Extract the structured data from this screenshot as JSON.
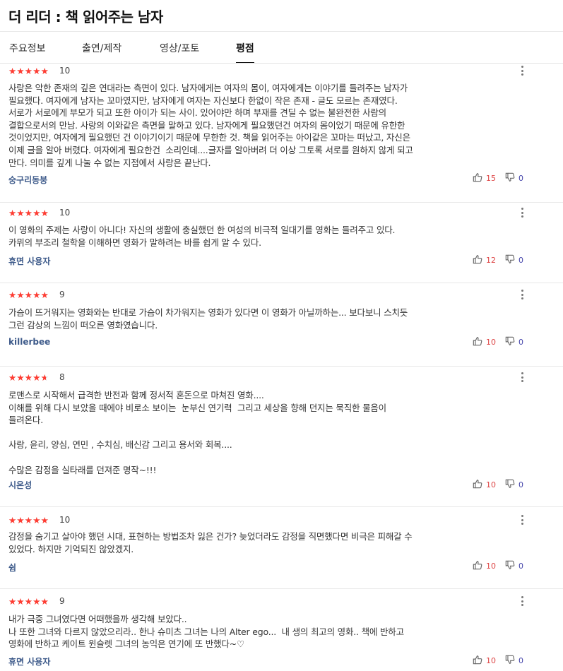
{
  "page": {
    "title": "더 리더 : 책 읽어주는 남자"
  },
  "tabs": [
    {
      "label": "주요정보",
      "active": false
    },
    {
      "label": "출연/제작",
      "active": false
    },
    {
      "label": "영상/포토",
      "active": false
    },
    {
      "label": "평점",
      "active": true
    }
  ],
  "reviews": [
    {
      "rating": 10,
      "score": "10",
      "text": "사랑은 악한 존재의 깊은 연대라는 측면이 있다. 남자에게는 여자의 몸이, 여자에게는 이야기를 들려주는 남자가\n필요했다. 여자에게 남자는 꼬마였지만, 남자에게 여자는 자신보다 한없이 작은 존재 - 글도 모르는 존재였다.\n서로가 서로에게 부모가 되고 또한 아이가 되는 사이. 있어야만 하며 부재를 견딜 수 없는 불완전한 사람의\n결합으로서의 만남. 사랑의 이와같은 측면을 말하고 있다. 남자에게 필요했던건 여자의 몸이었기 때문에 유한한\n것이었지만, 여자에게 필요했던 건 이야기이기 때문에 무한한 것. 책을 읽어주는 아이같은 꼬마는 떠났고, 자신은\n이제 글을 알아 버렸다. 여자에게 필요한건  소리인데....글자를 알아버려 더 이상 그토록 서로를 원하지 않게 되고\n만다. 의미를 깊게 나눌 수 없는 지점에서 사랑은 끝난다.",
      "user": "숭구리동붕",
      "likes": "15",
      "dislikes": "0"
    },
    {
      "rating": 10,
      "score": "10",
      "text": "이 영화의 주제는 사랑이 아니다! 자신의 생활에 충실했던 한 여성의 비극적 일대기를 영화는 들려주고 있다.\n카뮈의 부조리 철학을 이해하면 영화가 말하려는 바를 쉽게 알 수 있다.",
      "user": "휴면 사용자",
      "likes": "12",
      "dislikes": "0"
    },
    {
      "rating": 9,
      "score": "9",
      "text": "가슴이 뜨거워지는 영화와는 반대로 가슴이 차가워지는 영화가 있다면 이 영화가 아닐까하는... 보다보니 스치듯\n그런 감상의 느낌이 떠오른 영화였습니다.",
      "user": "killerbee",
      "likes": "10",
      "dislikes": "0"
    },
    {
      "rating": 8,
      "score": "8",
      "text": "로맨스로 시작해서 급격한 반전과 함께 정서적 혼돈으로 마쳐진 영화....\n이해를 위해 다시 보았을 때에야 비로소 보이는  눈부신 연기력  그리고 세상을 향해 던지는 묵직한 물음이\n들려온다.\n\n사랑, 윤리, 양심, 연민 , 수치심, 배신감 그리고 용서와 회복....\n\n수많은 감정을 실타래를 던져준 명작~!!!",
      "user": "시온성",
      "likes": "10",
      "dislikes": "0"
    },
    {
      "rating": 10,
      "score": "10",
      "text": "감정을 숨기고 살아야 했던 시대, 표현하는 방법조차 잃은 건가? 늦었더라도 감정을 직면했다면 비극은 피해갈 수\n있었다. 하지만 기억되진 않았겠지.",
      "user": "쉼",
      "likes": "10",
      "dislikes": "0"
    },
    {
      "rating": 9,
      "score": "9",
      "text": "내가 극중 그녀였다면 어떠했을까 생각해 보았다..\n나 또한 그녀와 다르지 않았으리라.. 한나 슈미츠 그녀는 나의 Alter ego...  내 생의 최고의 영화.. 책에 반하고\n영화에 반하고 케이트 윈슬렛 그녀의 농익은 연기에 또 반했다~♡",
      "user": "휴면 사용자",
      "likes": "10",
      "dislikes": "0"
    }
  ]
}
